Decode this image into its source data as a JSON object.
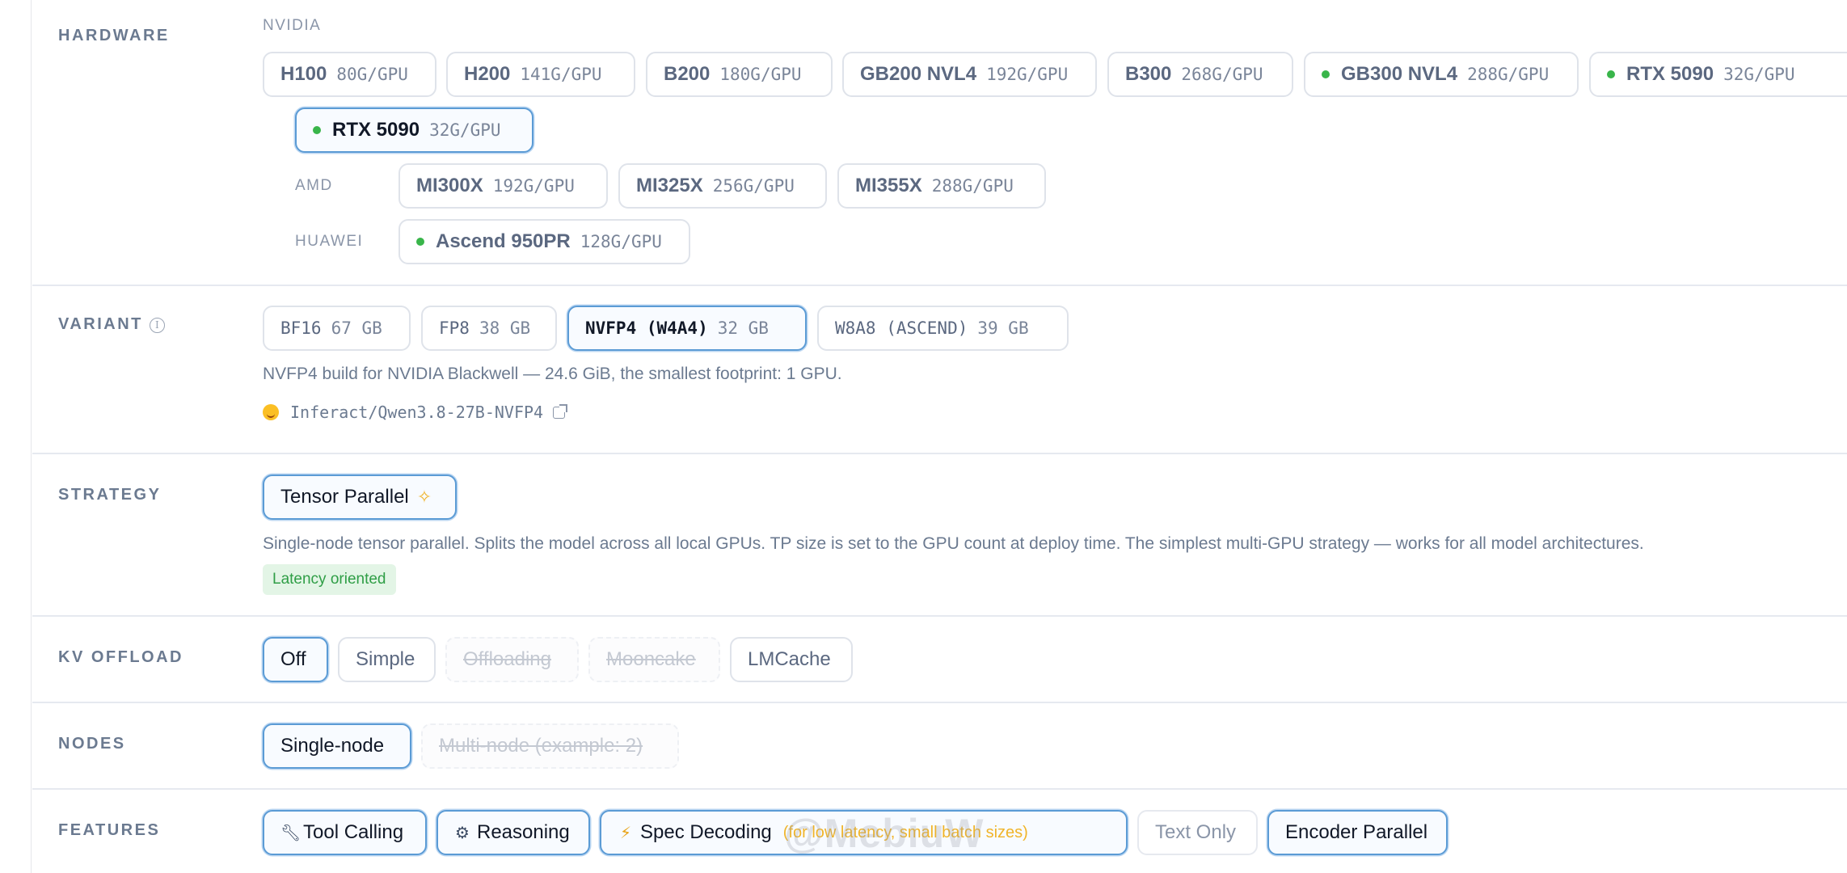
{
  "hardware": {
    "label": "HARDWARE",
    "nvidia_label": "NVIDIA",
    "amd_label": "AMD",
    "huawei_label": "HUAWEI",
    "nvidia": [
      {
        "name": "H100",
        "mem": "80G/GPU"
      },
      {
        "name": "H200",
        "mem": "141G/GPU"
      },
      {
        "name": "B200",
        "mem": "180G/GPU"
      },
      {
        "name": "GB200 NVL4",
        "mem": "192G/GPU"
      },
      {
        "name": "B300",
        "mem": "268G/GPU"
      },
      {
        "name": "GB300 NVL4",
        "mem": "288G/GPU",
        "status": "available"
      },
      {
        "name": "RTX 5090",
        "mem": "32G/GPU",
        "status": "available"
      },
      {
        "name": "RTX 5090",
        "mem": "32G/GPU",
        "status": "available",
        "selected": true
      }
    ],
    "amd": [
      {
        "name": "MI300X",
        "mem": "192G/GPU"
      },
      {
        "name": "MI325X",
        "mem": "256G/GPU"
      },
      {
        "name": "MI355X",
        "mem": "288G/GPU"
      }
    ],
    "huawei": [
      {
        "name": "Ascend 950PR",
        "mem": "128G/GPU",
        "status": "available"
      }
    ],
    "status_color": "#39b54a"
  },
  "variant": {
    "label": "VARIANT",
    "info_icon": "info-icon",
    "options": [
      {
        "name": "BF16",
        "size": "67 GB"
      },
      {
        "name": "FP8",
        "size": "38 GB"
      },
      {
        "name": "NVFP4 (W4A4)",
        "size": "32 GB",
        "selected": true
      },
      {
        "name": "W8A8 (ASCEND)",
        "size": "39 GB"
      }
    ],
    "description": "NVFP4 build for NVIDIA Blackwell — 24.6 GiB, the smallest footprint: 1 GPU.",
    "repo": "Inferact/Qwen3.8-27B-NVFP4"
  },
  "strategy": {
    "label": "STRATEGY",
    "option": "Tensor Parallel",
    "description": "Single-node tensor parallel. Splits the model across all local GPUs. TP size is set to the GPU count at deploy time. The simplest multi-GPU strategy — works for all model architectures.",
    "badge": "Latency oriented"
  },
  "kv_offload": {
    "label": "KV OFFLOAD",
    "options": [
      "Off",
      "Simple",
      "Offloading",
      "Mooncake",
      "LMCache"
    ]
  },
  "nodes": {
    "label": "NODES",
    "options": [
      "Single-node",
      "Multi-node (example: 2)"
    ]
  },
  "features": {
    "label": "FEATURES",
    "options": [
      "Tool Calling",
      "Reasoning",
      "Spec Decoding",
      "Text Only",
      "Encoder Parallel"
    ],
    "spec_note": "(for low latency, small batch sizes)"
  },
  "watermark": "@MebiuW",
  "accent_color": "#5b9bd5"
}
